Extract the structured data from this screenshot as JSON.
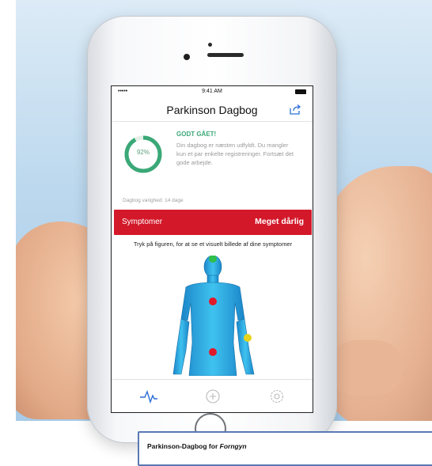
{
  "status_bar": {
    "signal": "•••••",
    "time": "9:41 AM"
  },
  "header": {
    "title": "Parkinson Dagbog",
    "share_icon": "share-icon"
  },
  "progress": {
    "percent": 92,
    "label": "92%",
    "color": "#3aa877"
  },
  "message": {
    "title": "GODT GÅET!",
    "body": "Din dagbog er næsten udfyldt. Du mangler kun et par enkelte registreringer. Fortsæt det gode arbejde."
  },
  "diary": {
    "duration": "Dagbog varighed: 14 dage"
  },
  "symptoms": {
    "label": "Symptomer",
    "severity": "Meget dårlig",
    "color": "#d3182a"
  },
  "instruction": "Tryk på figuren, for at se et visuelt billede af dine symptomer",
  "body_markers": [
    {
      "name": "head-marker",
      "color": "#2fbf4a"
    },
    {
      "name": "chest-marker",
      "color": "#e01a2a"
    },
    {
      "name": "abdomen-marker",
      "color": "#e01a2a"
    },
    {
      "name": "left-arm-marker",
      "color": "#e8d31c"
    }
  ],
  "tabbar": {
    "items": [
      {
        "icon": "activity-icon",
        "active": true
      },
      {
        "icon": "plus-circle-icon",
        "active": false
      },
      {
        "icon": "gear-icon",
        "active": false
      }
    ]
  },
  "caption": {
    "prefix": "Parkinson-Dagbog for ",
    "emphasis": "Forngyn"
  }
}
